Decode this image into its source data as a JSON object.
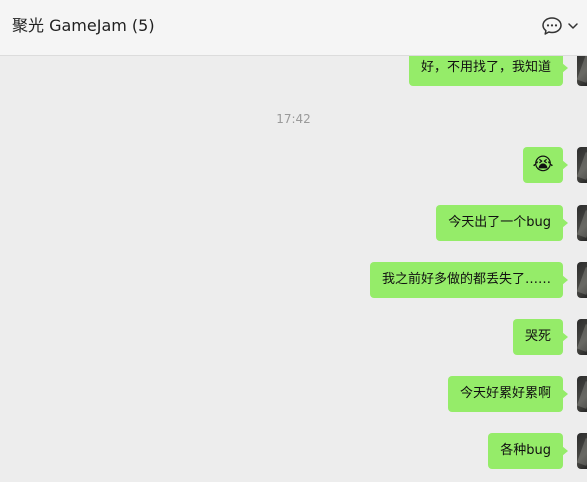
{
  "header": {
    "title": "聚光 GameJam (5)",
    "chat_icon": "chat-bubble-icon",
    "more_icon": "chevron-down-icon"
  },
  "messages": {
    "top_partial": "好，不用找了，我知道",
    "time": "17:42",
    "items": [
      {
        "kind": "emoji",
        "text": "😭"
      },
      {
        "kind": "text",
        "text": "今天出了一个bug"
      },
      {
        "kind": "text",
        "text": "我之前好多做的都丢失了……"
      },
      {
        "kind": "text",
        "text": "哭死"
      },
      {
        "kind": "text",
        "text": "今天好累好累啊"
      },
      {
        "kind": "text",
        "text": "各种bug"
      }
    ]
  },
  "colors": {
    "bubble": "#95ec69",
    "background": "#ededed",
    "header": "#f5f5f5"
  }
}
